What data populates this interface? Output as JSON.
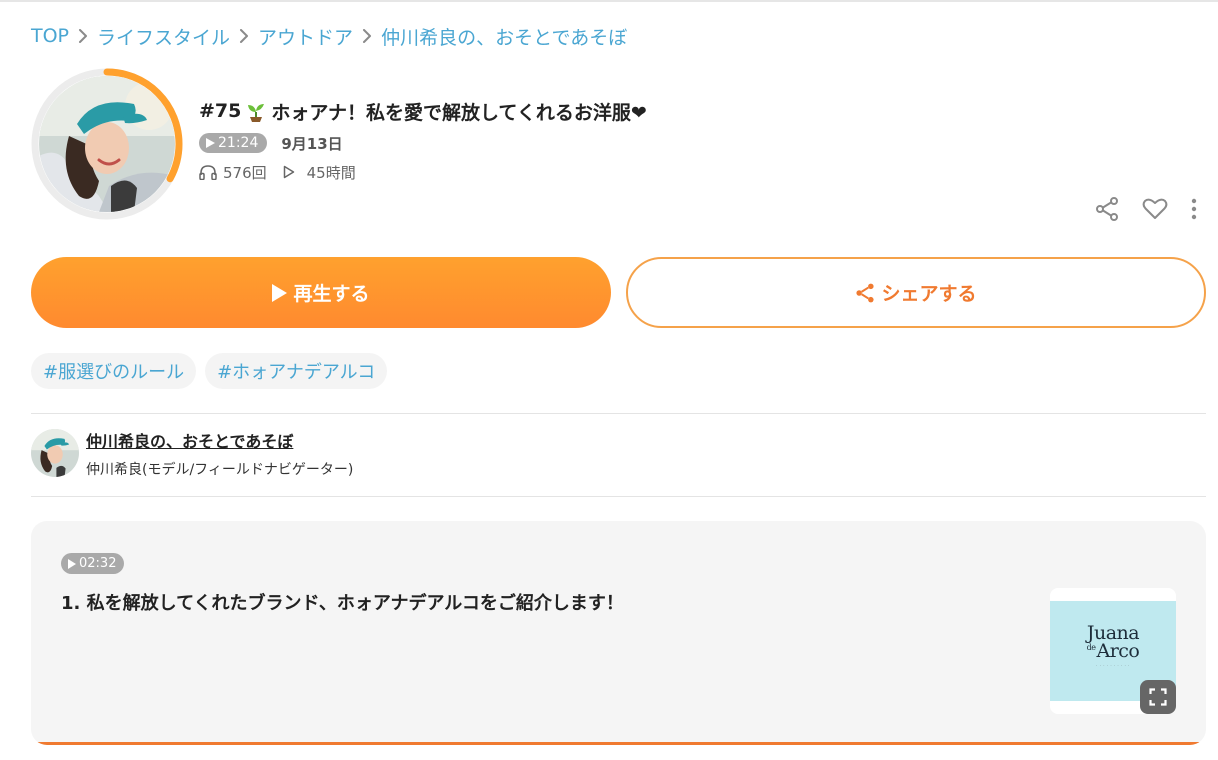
{
  "breadcrumb": {
    "items": [
      "TOP",
      "ライフスタイル",
      "アウトドア",
      "仲川希良の、おそとであそぼ"
    ]
  },
  "episode": {
    "number": "#75",
    "title": "ホォアナ！私を愛で解放してくれるお洋服❤",
    "duration": "21:24",
    "date": "9月13日",
    "listens": "576回",
    "play_hours": "45時間",
    "progress_fraction": 0.33
  },
  "buttons": {
    "play_label": "再生する",
    "share_label": "シェアする"
  },
  "tags": [
    "#服選びのルール",
    "#ホォアナデアルコ"
  ],
  "channel": {
    "name": "仲川希良の、おそとであそぼ",
    "host": "仲川希良(モデル/フィールドナビゲーター)"
  },
  "chapter": {
    "time": "02:32",
    "title": "1. 私を解放してくれたブランド、ホォアナデアルコをご紹介します！",
    "thumb_logo_line1": "Juana",
    "thumb_logo_de": "de",
    "thumb_logo_line2": "Arco"
  },
  "colors": {
    "accent_orange": "#ff8a2f",
    "link_blue": "#4aa6d2",
    "badge_gray": "#a9a9a9",
    "card_bg": "#f5f5f5"
  },
  "icons": {
    "share": "share-icon",
    "like": "heart-icon",
    "more": "more-vertical-icon",
    "listens": "headphones-icon",
    "plays": "play-outline-icon",
    "expand": "expand-icon"
  }
}
